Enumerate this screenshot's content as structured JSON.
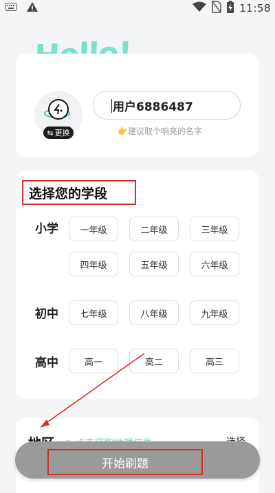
{
  "status_bar": {
    "time": "11:58"
  },
  "hello": "Hello!",
  "profile": {
    "avatar_badge": "更换",
    "username": "用户6886487",
    "hint": "👉建议取个响亮的名字"
  },
  "grade_section": {
    "title": "选择您的学段",
    "rows": [
      {
        "label": "小学",
        "grades": [
          "一年级",
          "二年级",
          "三年级",
          "四年级",
          "五年级",
          "六年级"
        ]
      },
      {
        "label": "初中",
        "grades": [
          "七年级",
          "八年级",
          "九年级"
        ]
      },
      {
        "label": "高中",
        "grades": [
          "高一",
          "高二",
          "高三"
        ]
      }
    ]
  },
  "region_section": {
    "title": "地区",
    "locate": "点击获取地理信息",
    "select": "选择"
  },
  "start_button": "开始刷题",
  "colors": {
    "accent": "#76e2c7",
    "highlight_red": "#d32f2f",
    "bottom_bar": "#9a9a9a"
  }
}
